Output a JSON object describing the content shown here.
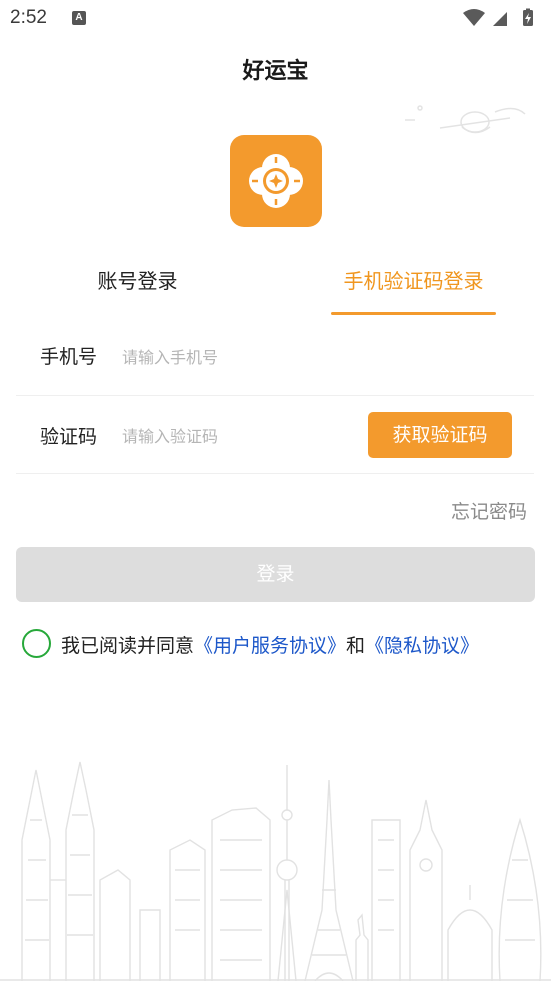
{
  "status_bar": {
    "time": "2:52",
    "notification_badge": "A",
    "icons": [
      "wifi-icon",
      "cell-signal-icon",
      "battery-charging-icon"
    ]
  },
  "app": {
    "title": "好运宝",
    "logo_icon": "clover-coin-icon",
    "accent_color": "#f39a2d"
  },
  "tabs": [
    {
      "label": "账号登录",
      "active": false
    },
    {
      "label": "手机验证码登录",
      "active": true
    }
  ],
  "form": {
    "phone": {
      "label": "手机号",
      "placeholder": "请输入手机号",
      "value": ""
    },
    "code": {
      "label": "验证码",
      "placeholder": "请输入验证码",
      "value": ""
    },
    "get_code_button": "获取验证码"
  },
  "forgot_password": "忘记密码",
  "login_button": "登录",
  "agreement": {
    "checked": false,
    "prefix": "我已阅读并同意",
    "user_agreement": "《用户服务协议》",
    "conjunction": "和",
    "privacy_policy": "《隐私协议》",
    "link_color": "#1c57c9"
  }
}
